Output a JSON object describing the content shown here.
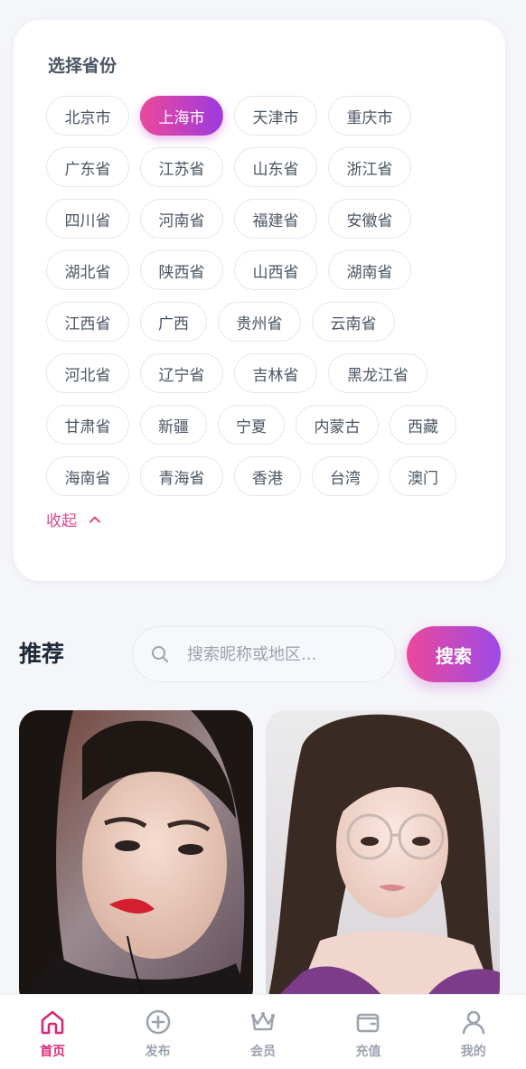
{
  "province_section": {
    "title": "选择省份",
    "rows": [
      [
        {
          "label": "北京市",
          "active": false
        },
        {
          "label": "上海市",
          "active": true
        },
        {
          "label": "天津市",
          "active": false
        },
        {
          "label": "重庆市",
          "active": false
        }
      ],
      [
        {
          "label": "广东省"
        },
        {
          "label": "江苏省"
        },
        {
          "label": "山东省"
        },
        {
          "label": "浙江省"
        }
      ],
      [
        {
          "label": "四川省"
        },
        {
          "label": "河南省"
        },
        {
          "label": "福建省"
        },
        {
          "label": "安徽省"
        }
      ],
      [
        {
          "label": "湖北省"
        },
        {
          "label": "陕西省"
        },
        {
          "label": "山西省"
        },
        {
          "label": "湖南省"
        }
      ],
      [
        {
          "label": "江西省"
        },
        {
          "label": "广西"
        },
        {
          "label": "贵州省"
        },
        {
          "label": "云南省"
        }
      ],
      [
        {
          "label": "河北省"
        },
        {
          "label": "辽宁省"
        },
        {
          "label": "吉林省"
        },
        {
          "label": "黑龙江省"
        }
      ],
      [
        {
          "label": "甘肃省"
        },
        {
          "label": "新疆"
        },
        {
          "label": "宁夏"
        },
        {
          "label": "内蒙古"
        },
        {
          "label": "西藏"
        }
      ],
      [
        {
          "label": "海南省"
        },
        {
          "label": "青海省"
        },
        {
          "label": "香港"
        },
        {
          "label": "台湾"
        },
        {
          "label": "澳门"
        }
      ]
    ],
    "collapse_label": "收起"
  },
  "recommend": {
    "title": "推荐",
    "search_placeholder": "搜索昵称或地区...",
    "search_button": "搜索"
  },
  "tabbar": {
    "items": [
      {
        "label": "首页",
        "icon": "home-icon",
        "active": true
      },
      {
        "label": "发布",
        "icon": "plus-circle-icon",
        "active": false
      },
      {
        "label": "会员",
        "icon": "crown-icon",
        "active": false
      },
      {
        "label": "充值",
        "icon": "wallet-icon",
        "active": false
      },
      {
        "label": "我的",
        "icon": "user-icon",
        "active": false
      }
    ]
  },
  "colors": {
    "accent_start": "#ec4899",
    "accent_end": "#9d3ae0",
    "active_tab": "#db2777",
    "inactive_tab": "#9ca3af"
  }
}
